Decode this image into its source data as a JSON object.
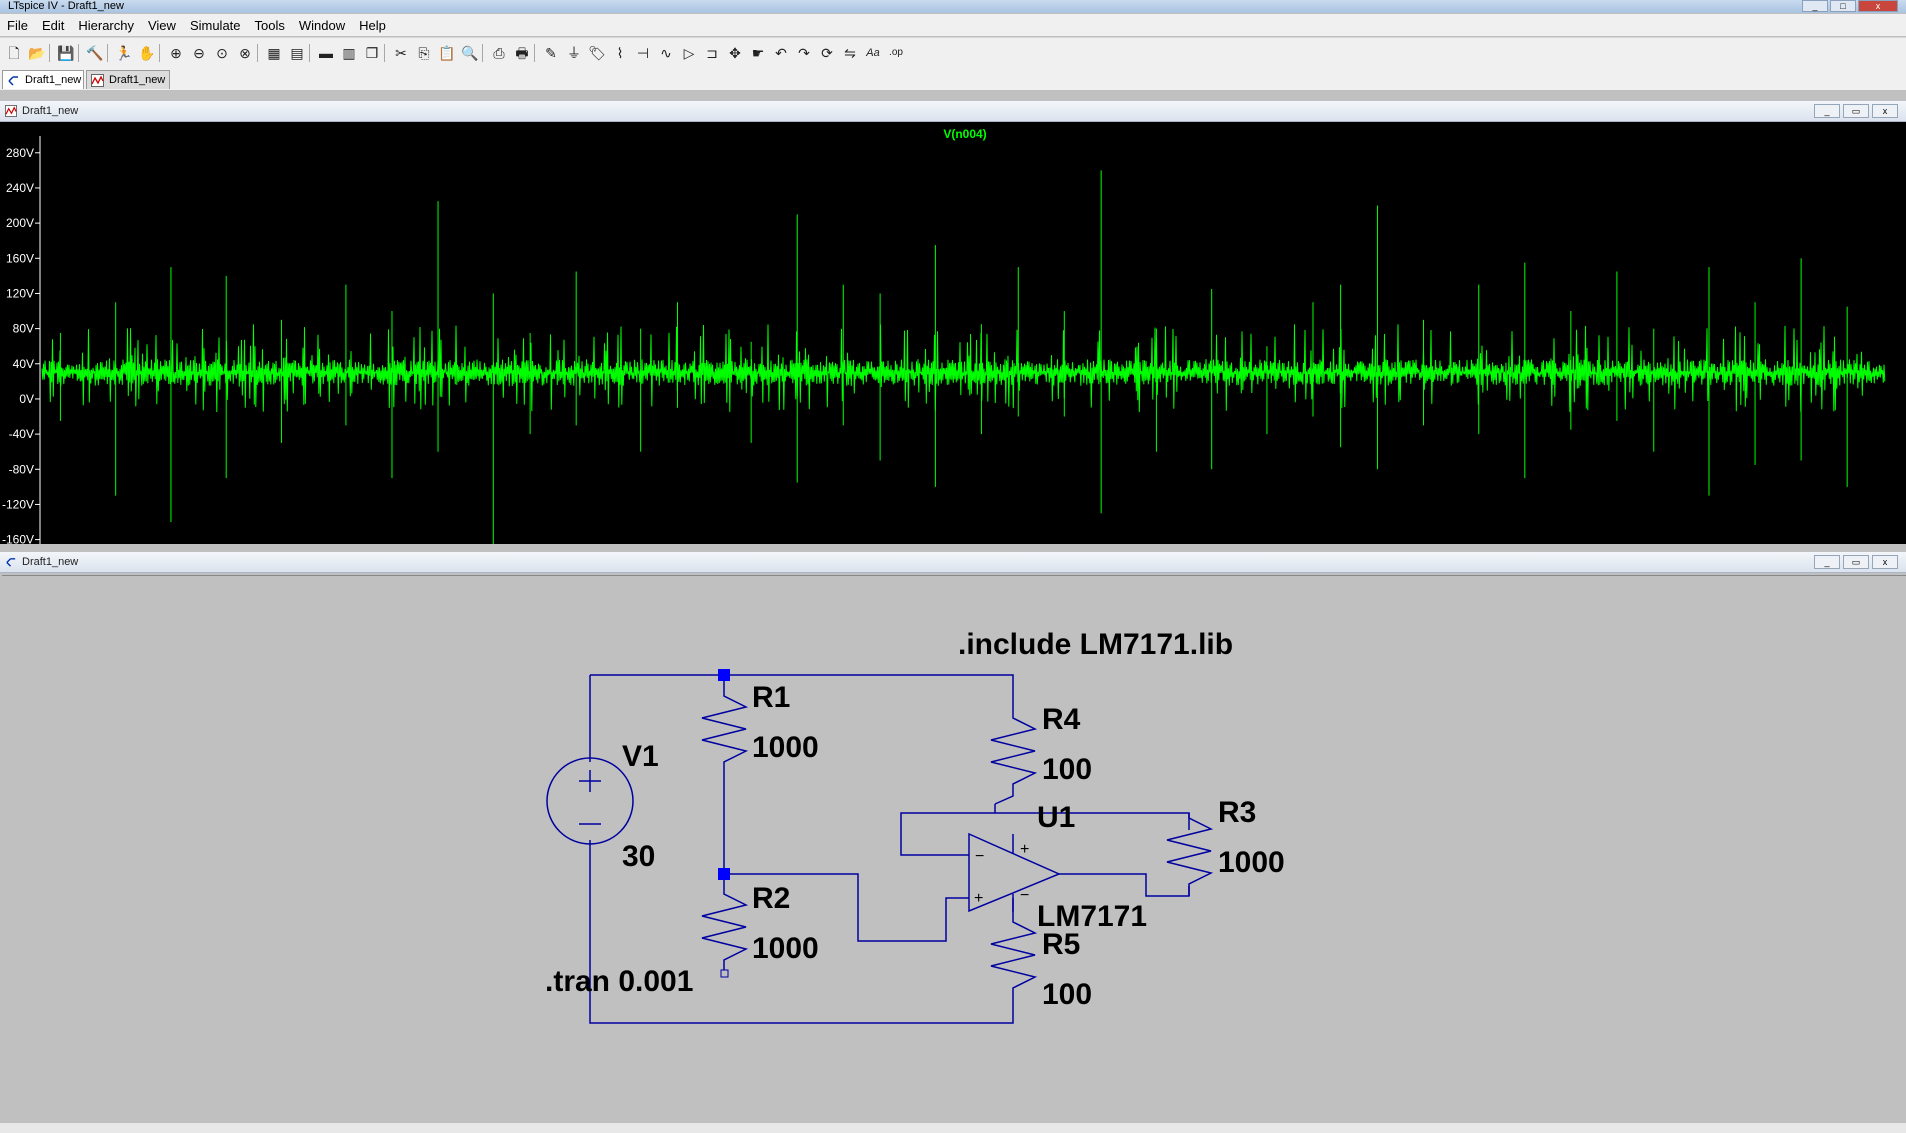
{
  "app": {
    "title": "LTspice IV - Draft1_new"
  },
  "menu": [
    "File",
    "Edit",
    "Hierarchy",
    "View",
    "Simulate",
    "Tools",
    "Window",
    "Help"
  ],
  "toolbar": {
    "icons": [
      "new-schematic-icon",
      "open-icon",
      "save-icon",
      "control-panel-icon",
      "run-icon",
      "halt-icon",
      "zoom-in-icon",
      "zoom-out-icon",
      "zoom-pan-icon",
      "zoom-fit-icon",
      "autorange-icon",
      "grid-icon",
      "tile-horizontal-icon",
      "tile-vertical-icon",
      "cascade-icon",
      "cut-icon",
      "copy-icon",
      "paste-icon",
      "find-icon",
      "print-setup-icon",
      "print-icon",
      "draw-wire-icon",
      "ground-icon",
      "label-net-icon",
      "resistor-icon",
      "capacitor-icon",
      "inductor-icon",
      "diode-icon",
      "component-icon",
      "move-icon",
      "drag-icon",
      "undo-icon",
      "redo-icon",
      "rotate-icon",
      "mirror-icon",
      "text-icon",
      "spice-directive-icon"
    ],
    "text_glyphs": {
      "text": "Aa",
      "directive": ".op"
    }
  },
  "tabs": [
    {
      "label": "Draft1_new",
      "kind": "schematic",
      "active": true
    },
    {
      "label": "Draft1_new",
      "kind": "waveform",
      "active": false
    }
  ],
  "plot_pane": {
    "title": "Draft1_new",
    "trace_label": "V(n004)",
    "trace_color": "#00ff00",
    "background": "#000000"
  },
  "chart_data": {
    "type": "line",
    "title": "",
    "series": [
      {
        "name": "V(n004)",
        "color": "#00ff00"
      }
    ],
    "y_ticks": [
      "280V",
      "240V",
      "200V",
      "160V",
      "120V",
      "80V",
      "40V",
      "0V",
      "-40V",
      "-80V",
      "-120V",
      "-160V"
    ],
    "y_tick_values": [
      280,
      240,
      200,
      160,
      120,
      80,
      40,
      0,
      -40,
      -80,
      -120,
      -160
    ],
    "ylim": [
      -165,
      290
    ],
    "baseline_value": 30,
    "noise_band": 10,
    "spike_values": [
      [
        0.01,
        75,
        -25
      ],
      [
        0.04,
        110,
        -110
      ],
      [
        0.07,
        150,
        -140
      ],
      [
        0.1,
        140,
        -90
      ],
      [
        0.13,
        90,
        -50
      ],
      [
        0.165,
        130,
        -30
      ],
      [
        0.19,
        100,
        -90
      ],
      [
        0.215,
        225,
        -60
      ],
      [
        0.245,
        120,
        -190
      ],
      [
        0.265,
        75,
        -40
      ],
      [
        0.29,
        145,
        -30
      ],
      [
        0.325,
        80,
        -60
      ],
      [
        0.345,
        110,
        -10
      ],
      [
        0.385,
        65,
        -50
      ],
      [
        0.41,
        210,
        -95
      ],
      [
        0.435,
        130,
        -30
      ],
      [
        0.455,
        120,
        -70
      ],
      [
        0.485,
        175,
        -100
      ],
      [
        0.51,
        85,
        -40
      ],
      [
        0.53,
        150,
        -20
      ],
      [
        0.555,
        100,
        -20
      ],
      [
        0.575,
        260,
        -130
      ],
      [
        0.605,
        80,
        -60
      ],
      [
        0.635,
        125,
        -80
      ],
      [
        0.665,
        60,
        -40
      ],
      [
        0.69,
        110,
        -20
      ],
      [
        0.705,
        130,
        -55
      ],
      [
        0.725,
        220,
        -80
      ],
      [
        0.75,
        90,
        -30
      ],
      [
        0.78,
        130,
        -40
      ],
      [
        0.805,
        155,
        -90
      ],
      [
        0.83,
        100,
        -35
      ],
      [
        0.855,
        145,
        -25
      ],
      [
        0.875,
        80,
        -60
      ],
      [
        0.905,
        150,
        -110
      ],
      [
        0.93,
        110,
        -75
      ],
      [
        0.955,
        160,
        -70
      ],
      [
        0.98,
        105,
        -100
      ]
    ]
  },
  "schematic_pane": {
    "title": "Draft1_new",
    "wire_color": "#0000a0",
    "junction_color": "#0000ff",
    "directives": [
      ".include LM7171.lib",
      ".tran 0.001"
    ],
    "components": {
      "V1": {
        "name": "V1",
        "value": "30"
      },
      "R1": {
        "name": "R1",
        "value": "1000"
      },
      "R2": {
        "name": "R2",
        "value": "1000"
      },
      "R3": {
        "name": "R3",
        "value": "1000"
      },
      "R4": {
        "name": "R4",
        "value": "100"
      },
      "R5": {
        "name": "R5",
        "value": "100"
      },
      "U1": {
        "name": "U1",
        "value": "LM7171"
      }
    },
    "opamp_pin_signs": {
      "plus": "+",
      "minus": "−"
    }
  }
}
